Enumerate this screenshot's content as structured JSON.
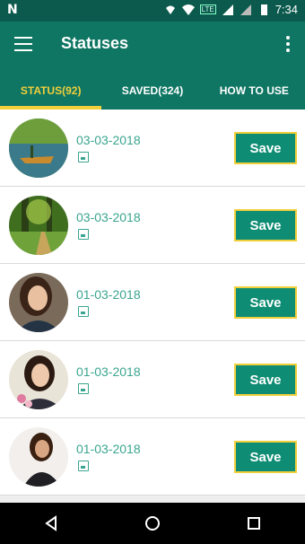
{
  "status_bar": {
    "time": "7:34",
    "network": "LTE"
  },
  "app": {
    "title": "Statuses"
  },
  "tabs": [
    {
      "label": "STATUS(92)",
      "active": true
    },
    {
      "label": "SAVED(324)",
      "active": false
    },
    {
      "label": "HOW TO USE",
      "active": false
    }
  ],
  "items": [
    {
      "date": "03-03-2018",
      "save_label": "Save",
      "thumb": "boat-on-lake"
    },
    {
      "date": "03-03-2018",
      "save_label": "Save",
      "thumb": "forest-path"
    },
    {
      "date": "01-03-2018",
      "save_label": "Save",
      "thumb": "woman-portrait"
    },
    {
      "date": "01-03-2018",
      "save_label": "Save",
      "thumb": "woman-flowers"
    },
    {
      "date": "01-03-2018",
      "save_label": "Save",
      "thumb": "woman-posing"
    }
  ],
  "colors": {
    "primary": "#0f7663",
    "dark": "#0b5a4d",
    "accent": "#f1cf3b",
    "date_text": "#3aa58f"
  }
}
